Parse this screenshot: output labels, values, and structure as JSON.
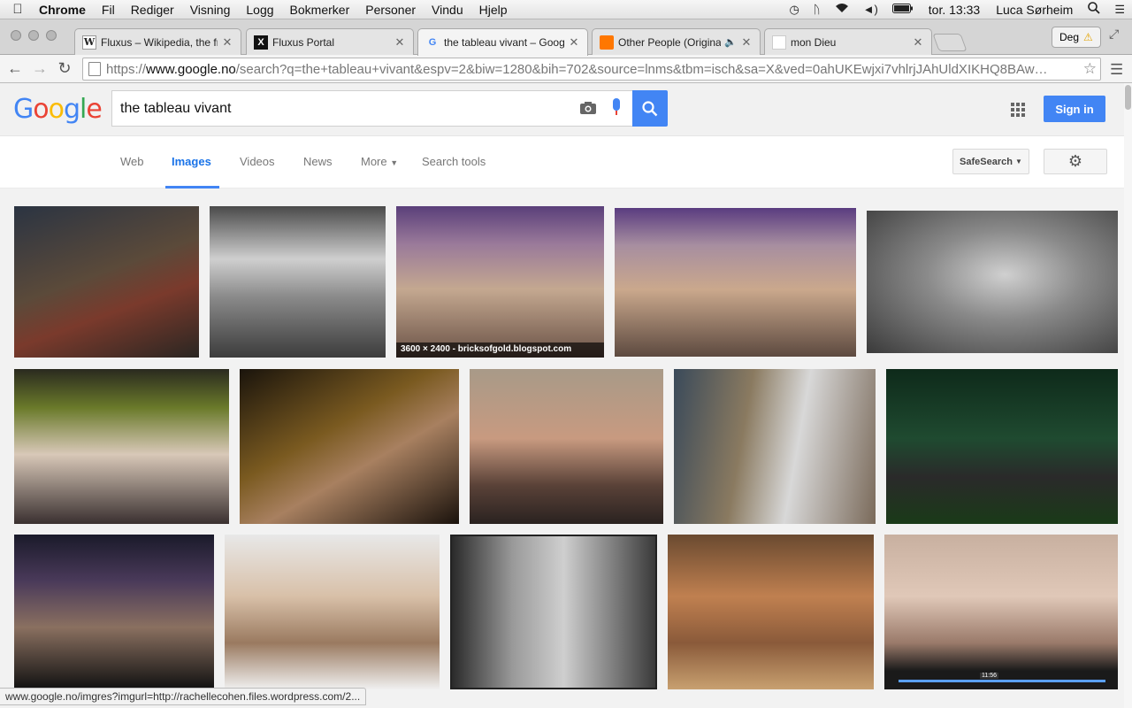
{
  "menubar": {
    "app": "Chrome",
    "items": [
      "Fil",
      "Rediger",
      "Visning",
      "Logg",
      "Bokmerker",
      "Personer",
      "Vindu",
      "Hjelp"
    ],
    "clock": "tor. 13:33",
    "user": "Luca Sørheim"
  },
  "tabs": [
    {
      "favicon": "W",
      "title": "Fluxus – Wikipedia, the free",
      "active": false
    },
    {
      "favicon": "X",
      "title": "Fluxus Portal",
      "active": false
    },
    {
      "favicon": "G",
      "title": "the tableau vivant – Google",
      "active": true
    },
    {
      "favicon": "soundcloud",
      "title": "Other People (Original)",
      "active": false,
      "audio": true
    },
    {
      "favicon": "blank",
      "title": "mon Dieu",
      "active": false
    }
  ],
  "profile": {
    "label": "Deg"
  },
  "omnibox": {
    "scheme": "https://",
    "host": "www.google.no",
    "path": "/search?q=the+tableau+vivant&espv=2&biw=1280&bih=702&source=lnms&tbm=isch&sa=X&ved=0ahUKEwjxi7vhlrjJAhUldXIKHQ8BAw…"
  },
  "search": {
    "query": "the tableau vivant",
    "sign_in": "Sign in"
  },
  "nav": {
    "web": "Web",
    "images": "Images",
    "videos": "Videos",
    "news": "News",
    "more": "More",
    "tools": "Search tools",
    "safesearch": "SafeSearch"
  },
  "images": [
    {
      "caption": ""
    },
    {
      "caption": ""
    },
    {
      "caption": "3600 × 2400 - bricksofgold.blogspot.com"
    },
    {
      "caption": ""
    },
    {
      "caption": ""
    },
    {
      "caption": ""
    },
    {
      "caption": ""
    },
    {
      "caption": ""
    },
    {
      "caption": ""
    },
    {
      "caption": ""
    },
    {
      "caption": ""
    },
    {
      "caption": ""
    },
    {
      "caption": ""
    },
    {
      "caption": ""
    },
    {
      "caption": "",
      "video_time": "11:56"
    }
  ],
  "status": {
    "url": "www.google.no/imgres?imgurl=http://rachellecohen.files.wordpress.com/2..."
  }
}
